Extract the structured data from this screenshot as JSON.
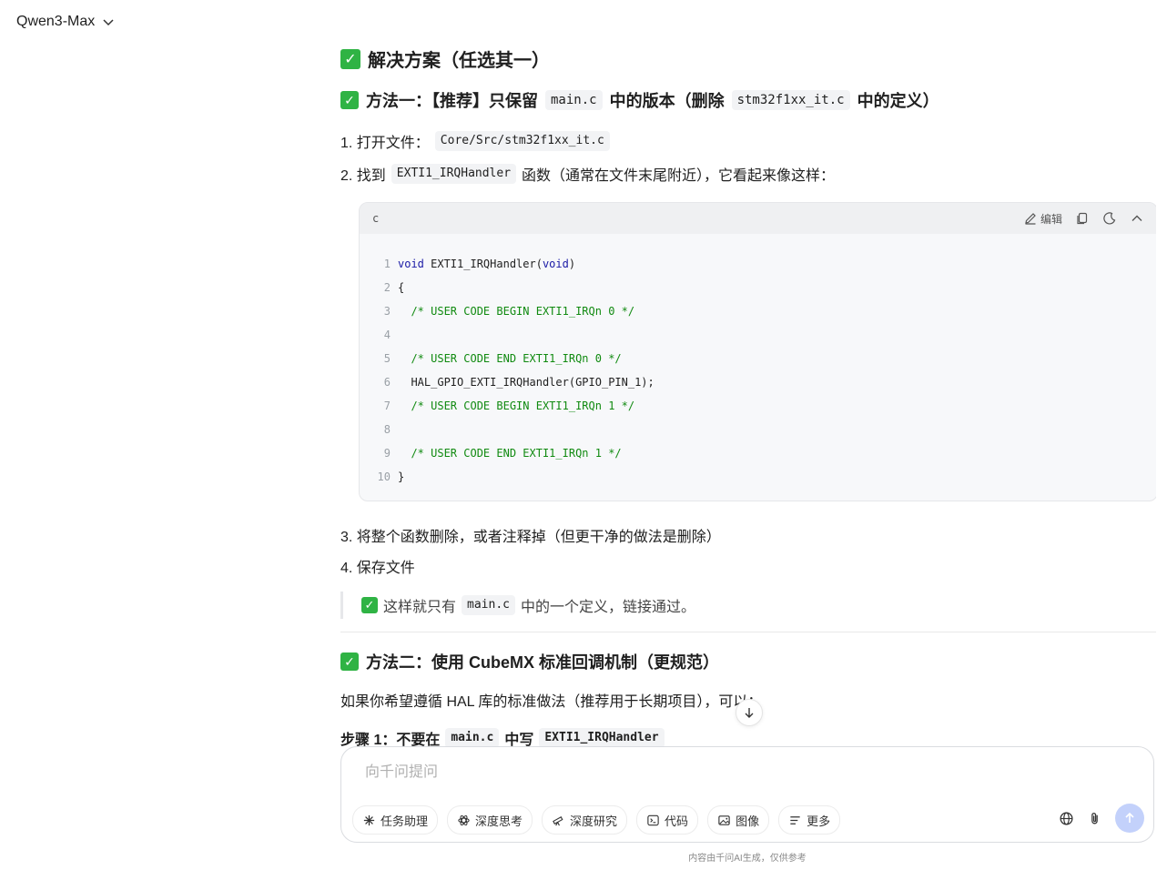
{
  "header": {
    "model_name": "Qwen3-Max"
  },
  "content": {
    "solutions_title": "解决方案（任选其一）",
    "method1": {
      "title_pre": "方法一：【推荐】只保留",
      "code1": "main.c",
      "title_mid": "中的版本（删除",
      "code2": "stm32f1xx_it.c",
      "title_post": "中的定义）"
    },
    "step1": {
      "text": "1. 打开文件：",
      "code": "Core/Src/stm32f1xx_it.c"
    },
    "step2": {
      "pre": "2. 找到",
      "code": "EXTI1_IRQHandler",
      "post": "函数（通常在文件末尾附近），它看起来像这样："
    },
    "code_block": {
      "lang": "c",
      "edit_label": "编辑",
      "lines": [
        {
          "n": "1",
          "kw1": "void",
          "txt": " EXTI1_IRQHandler(",
          "kw2": "void",
          "end": ")"
        },
        {
          "n": "2",
          "code": "{"
        },
        {
          "n": "3",
          "comment": "  /* USER CODE BEGIN EXTI1_IRQn 0 */"
        },
        {
          "n": "4",
          "code": ""
        },
        {
          "n": "5",
          "comment": "  /* USER CODE END EXTI1_IRQn 0 */"
        },
        {
          "n": "6",
          "code": "  HAL_GPIO_EXTI_IRQHandler(GPIO_PIN_1);"
        },
        {
          "n": "7",
          "comment": "  /* USER CODE BEGIN EXTI1_IRQn 1 */"
        },
        {
          "n": "8",
          "code": ""
        },
        {
          "n": "9",
          "comment": "  /* USER CODE END EXTI1_IRQn 1 */"
        },
        {
          "n": "10",
          "code": "}"
        }
      ]
    },
    "step3": "3. 将整个函数删除，或者注释掉（但更干净的做法是删除）",
    "step4": "4. 保存文件",
    "quote": {
      "pre": "这样就只有",
      "code": "main.c",
      "post": "中的一个定义，链接通过。"
    },
    "method2_title": "方法二：使用 CubeMX 标准回调机制（更规范）",
    "method2_intro": "如果你希望遵循 HAL 库的标准做法（推荐用于长期项目），可以：",
    "step_b1": {
      "pre": "步骤 1：不要在",
      "code1": "main.c",
      "mid": "中写",
      "code2": "EXTI1_IRQHandler"
    }
  },
  "input": {
    "placeholder": "向千问提问",
    "chips": [
      {
        "label": "任务助理",
        "icon": "sparkle-icon"
      },
      {
        "label": "深度思考",
        "icon": "atom-icon"
      },
      {
        "label": "深度研究",
        "icon": "telescope-icon"
      },
      {
        "label": "代码",
        "icon": "terminal-icon"
      },
      {
        "label": "图像",
        "icon": "image-icon"
      },
      {
        "label": "更多",
        "icon": "menu-icon"
      }
    ]
  },
  "footer": {
    "note": "内容由千问AI生成，仅供参考"
  },
  "colors": {
    "check_green": "#2fb344",
    "keyword_blue": "#1a1aa6",
    "comment_green": "#108a10",
    "send_bg": "#c3d1fb"
  }
}
